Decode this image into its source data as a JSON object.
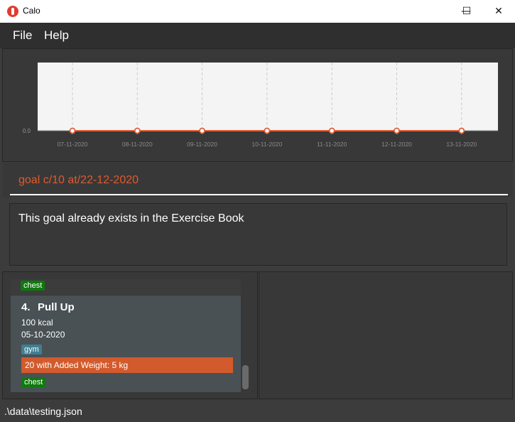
{
  "window": {
    "title": "Calo",
    "minimize": "—",
    "maximize": "☐",
    "close": "✕"
  },
  "menu": {
    "file": "File",
    "help": "Help"
  },
  "chart_data": {
    "type": "line",
    "categories": [
      "07-11-2020",
      "08-11-2020",
      "09-11-2020",
      "10-11-2020",
      "11-11-2020",
      "12-11-2020",
      "13-11-2020"
    ],
    "series": [
      {
        "values": [
          0,
          0,
          0,
          0,
          0,
          0,
          0
        ]
      }
    ],
    "y_tick_label": "0.0",
    "ylim": [
      0,
      1
    ],
    "grid": "vertical dashed",
    "line_color": "#e0603a"
  },
  "command": {
    "value": "goal c/10 at/22-12-2020"
  },
  "result": {
    "message": "This goal already exists in the Exercise Book"
  },
  "list": {
    "previous_tag": "chest",
    "card": {
      "index": "4.",
      "name": "Pull Up",
      "calories": "100  kcal",
      "date": "05-10-2020",
      "tag": "gym",
      "set": "20 with Added Weight: 5 kg",
      "muscle": "chest"
    }
  },
  "status": {
    "path": ".\\data\\testing.json"
  }
}
